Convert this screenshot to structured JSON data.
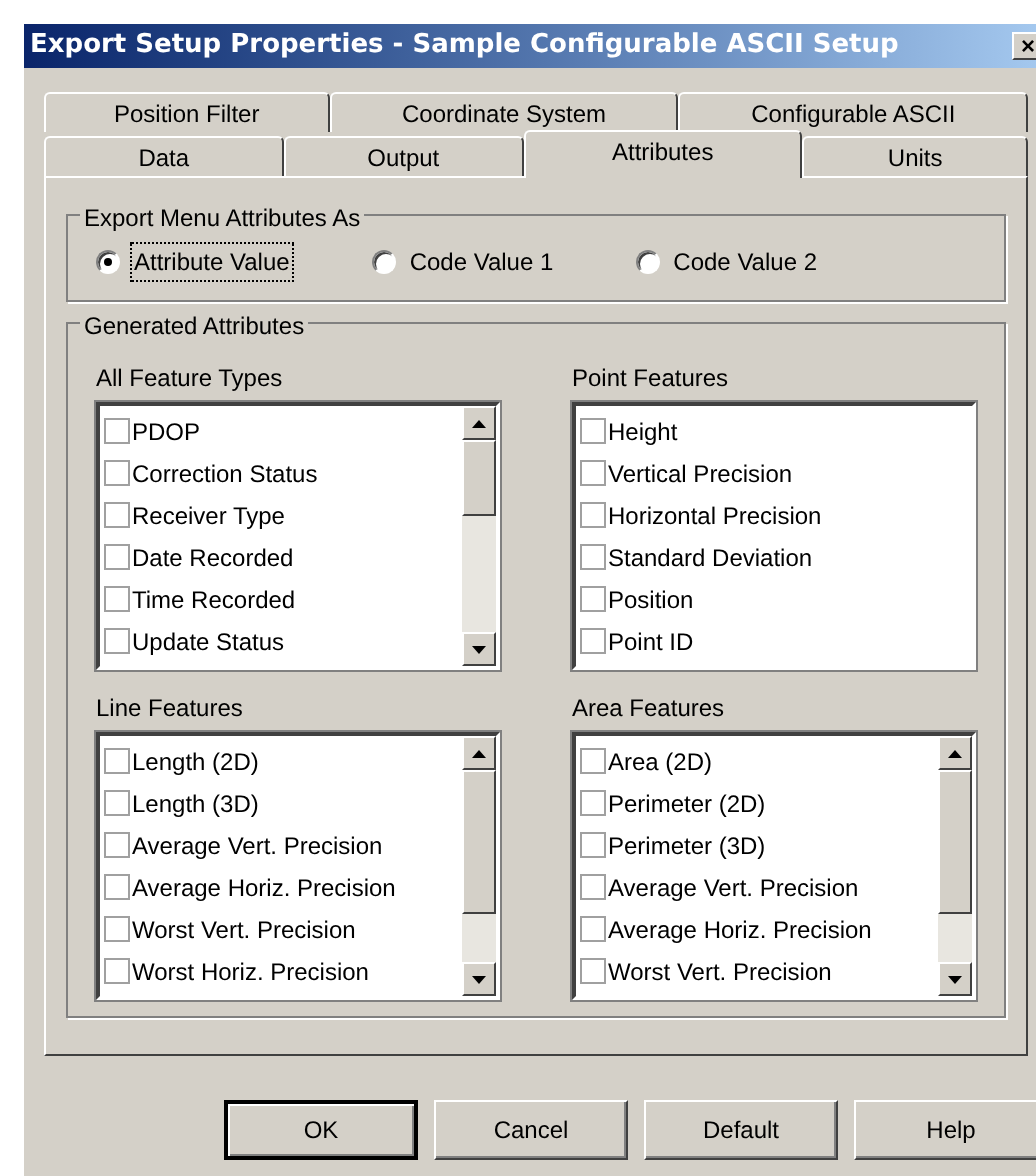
{
  "window": {
    "title": "Export Setup Properties - Sample Configurable ASCII Setup",
    "close": "×"
  },
  "tab_rows": [
    {
      "tabs": [
        {
          "label": "Position Filter",
          "selected": false
        },
        {
          "label": "Coordinate System",
          "selected": false
        },
        {
          "label": "Configurable ASCII",
          "selected": false
        }
      ]
    },
    {
      "tabs": [
        {
          "label": "Data",
          "selected": false
        },
        {
          "label": "Output",
          "selected": false
        },
        {
          "label": "Attributes",
          "selected": true
        },
        {
          "label": "Units",
          "selected": false
        }
      ]
    }
  ],
  "export_as": {
    "title": "Export Menu Attributes As",
    "options": [
      {
        "label": "Attribute Value",
        "selected": true,
        "focused": true
      },
      {
        "label": "Code Value 1",
        "selected": false,
        "focused": false
      },
      {
        "label": "Code Value 2",
        "selected": false,
        "focused": false
      }
    ]
  },
  "generated": {
    "title": "Generated Attributes",
    "lists": [
      {
        "label": "All Feature Types",
        "scrollbar": true,
        "items": [
          {
            "label": "PDOP",
            "checked": false
          },
          {
            "label": "Correction Status",
            "checked": false
          },
          {
            "label": "Receiver Type",
            "checked": false
          },
          {
            "label": "Date Recorded",
            "checked": false
          },
          {
            "label": "Time Recorded",
            "checked": false
          },
          {
            "label": "Update Status",
            "checked": false
          }
        ]
      },
      {
        "label": "Point Features",
        "scrollbar": false,
        "items": [
          {
            "label": "Height",
            "checked": false
          },
          {
            "label": "Vertical Precision",
            "checked": false
          },
          {
            "label": "Horizontal Precision",
            "checked": false
          },
          {
            "label": "Standard Deviation",
            "checked": false
          },
          {
            "label": "Position",
            "checked": false
          },
          {
            "label": "Point ID",
            "checked": false
          }
        ]
      },
      {
        "label": "Line Features",
        "scrollbar": true,
        "items": [
          {
            "label": "Length (2D)",
            "checked": false
          },
          {
            "label": "Length (3D)",
            "checked": false
          },
          {
            "label": "Average Vert. Precision",
            "checked": false
          },
          {
            "label": "Average Horiz. Precision",
            "checked": false
          },
          {
            "label": "Worst Vert. Precision",
            "checked": false
          },
          {
            "label": "Worst Horiz. Precision",
            "checked": false
          }
        ]
      },
      {
        "label": "Area Features",
        "scrollbar": true,
        "items": [
          {
            "label": "Area (2D)",
            "checked": false
          },
          {
            "label": "Perimeter (2D)",
            "checked": false
          },
          {
            "label": "Perimeter (3D)",
            "checked": false
          },
          {
            "label": "Average Vert. Precision",
            "checked": false
          },
          {
            "label": "Average Horiz. Precision",
            "checked": false
          },
          {
            "label": "Worst Vert. Precision",
            "checked": false
          }
        ]
      }
    ]
  },
  "buttons": [
    {
      "label": "OK",
      "default": true
    },
    {
      "label": "Cancel",
      "default": false
    },
    {
      "label": "Default",
      "default": false
    },
    {
      "label": "Help",
      "default": false
    }
  ]
}
